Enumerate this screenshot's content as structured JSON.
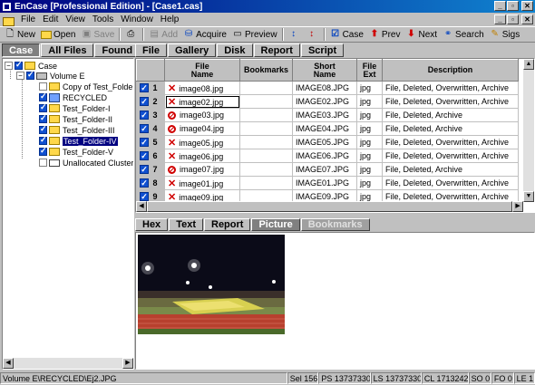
{
  "window": {
    "title": "EnCase [Professional Edition] - [Case1.cas]"
  },
  "menu": {
    "items": [
      "File",
      "Edit",
      "View",
      "Tools",
      "Window",
      "Help"
    ]
  },
  "toolbar": {
    "new": "New",
    "open": "Open",
    "save": "Save",
    "add": "Add",
    "acquire": "Acquire",
    "preview": "Preview",
    "case": "Case",
    "prev": "Prev",
    "next": "Next",
    "search": "Search",
    "sigs": "Sigs"
  },
  "tabs": [
    "Case",
    "All Files",
    "Found",
    "File",
    "Gallery",
    "Disk",
    "Report",
    "Script"
  ],
  "tree": {
    "items": [
      {
        "label": "Case"
      },
      {
        "label": "Volume E"
      },
      {
        "label": "Copy of Test_Folder-IV"
      },
      {
        "label": "RECYCLED"
      },
      {
        "label": "Test_Folder-I"
      },
      {
        "label": "Test_Folder-II"
      },
      {
        "label": "Test_Folder-III"
      },
      {
        "label": "Test_Folder-IV"
      },
      {
        "label": "Test_Folder-V"
      },
      {
        "label": "Unallocated Clusters"
      }
    ]
  },
  "table": {
    "columns": [
      {
        "label": "File\nName"
      },
      {
        "label": "Bookmarks"
      },
      {
        "label": "Short\nName"
      },
      {
        "label": "File\nExt"
      },
      {
        "label": "Description"
      }
    ],
    "rows": [
      {
        "num": "1",
        "icon": "deleted-x-icon",
        "name": "image08.jpg",
        "bookmarks": "",
        "short": "IMAGE08.JPG",
        "ext": "jpg",
        "desc": "File, Deleted, Overwritten, Archive"
      },
      {
        "num": "2",
        "icon": "deleted-x-icon",
        "name": "image02.jpg",
        "bookmarks": "",
        "short": "IMAGE02.JPG",
        "ext": "jpg",
        "desc": "File, Deleted, Overwritten, Archive"
      },
      {
        "num": "3",
        "icon": "deleted-circle-icon",
        "name": "image03.jpg",
        "bookmarks": "",
        "short": "IMAGE03.JPG",
        "ext": "jpg",
        "desc": "File, Deleted, Archive"
      },
      {
        "num": "4",
        "icon": "deleted-circle-icon",
        "name": "image04.jpg",
        "bookmarks": "",
        "short": "IMAGE04.JPG",
        "ext": "jpg",
        "desc": "File, Deleted, Archive"
      },
      {
        "num": "5",
        "icon": "deleted-x-icon",
        "name": "image05.jpg",
        "bookmarks": "",
        "short": "IMAGE05.JPG",
        "ext": "jpg",
        "desc": "File, Deleted, Overwritten, Archive"
      },
      {
        "num": "6",
        "icon": "deleted-x-icon",
        "name": "image06.jpg",
        "bookmarks": "",
        "short": "IMAGE06.JPG",
        "ext": "jpg",
        "desc": "File, Deleted, Overwritten, Archive"
      },
      {
        "num": "7",
        "icon": "deleted-circle-icon",
        "name": "image07.jpg",
        "bookmarks": "",
        "short": "IMAGE07.JPG",
        "ext": "jpg",
        "desc": "File, Deleted, Archive"
      },
      {
        "num": "8",
        "icon": "deleted-x-icon",
        "name": "image01.jpg",
        "bookmarks": "",
        "short": "IMAGE01.JPG",
        "ext": "jpg",
        "desc": "File, Deleted, Overwritten, Archive"
      },
      {
        "num": "9",
        "icon": "deleted-x-icon",
        "name": "image09.jpg",
        "bookmarks": "",
        "short": "IMAGE09.JPG",
        "ext": "jpg",
        "desc": "File, Deleted, Overwritten, Archive"
      }
    ]
  },
  "viewer_tabs": [
    "Hex",
    "Text",
    "Report",
    "Picture",
    "Bookmarks"
  ],
  "status": {
    "path": "Volume E\\RECYCLED\\Ej2.JPG",
    "sel": "Sel 156",
    "ps": "PS 13737330",
    "ls": "LS 13737330",
    "cl": "CL 1713242",
    "so": "SO 0",
    "fo": "FO 0",
    "le": "LE 1"
  },
  "colors": {
    "titlebar": "#000080",
    "deleted_marker": "#d00000",
    "selection": "#000080"
  }
}
